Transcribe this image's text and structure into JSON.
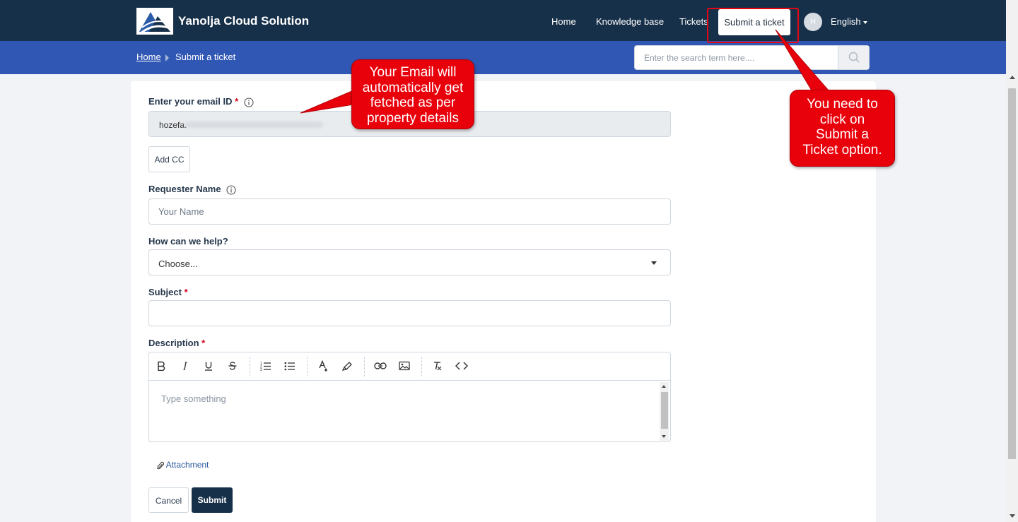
{
  "header": {
    "brand": "Yanolja Cloud Solution",
    "nav": [
      "Home",
      "Knowledge base",
      "Tickets"
    ],
    "submit_ticket": "Submit a ticket",
    "avatar_initial": "H",
    "language": "English"
  },
  "breadcrumb": {
    "home": "Home",
    "current": "Submit a ticket"
  },
  "search": {
    "placeholder": "Enter the search term here...."
  },
  "form": {
    "email_label": "Enter your email ID",
    "email_value": "hozefa.",
    "add_cc": "Add CC",
    "requester_label": "Requester Name",
    "requester_placeholder": "Your Name",
    "help_label": "How can we help?",
    "help_selected": "Choose...",
    "subject_label": "Subject",
    "subject_value": "",
    "description_label": "Description",
    "description_placeholder": "Type something",
    "required_mark": "*",
    "attachment": "Attachment",
    "cancel": "Cancel",
    "submit": "Submit"
  },
  "callouts": {
    "email": [
      "Your Email will",
      "automatically get",
      "fetched as per",
      "property details"
    ],
    "submit": [
      "You need to",
      "click on",
      "Submit a",
      "Ticket option."
    ]
  },
  "colors": {
    "header": "#173049",
    "band": "#3057b3",
    "callout": "#e8000b",
    "submit_button": "#173049"
  }
}
